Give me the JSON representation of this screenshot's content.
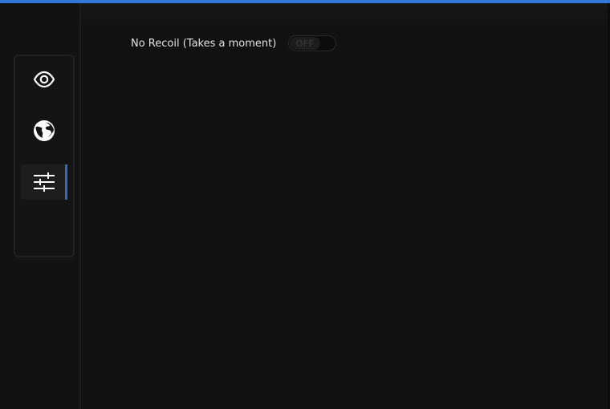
{
  "window": {
    "accent_color": "#2f79d6",
    "background_color": "#111111"
  },
  "sidebar": {
    "items": [
      {
        "icon": "eye-icon",
        "active": false
      },
      {
        "icon": "globe-icon",
        "active": false
      },
      {
        "icon": "sliders-icon",
        "active": true
      }
    ],
    "active_indicator_color": "#2f6bc4"
  },
  "settings": {
    "no_recoil": {
      "label": "No Recoil (Takes a moment)",
      "toggle_state": "OFF"
    }
  }
}
